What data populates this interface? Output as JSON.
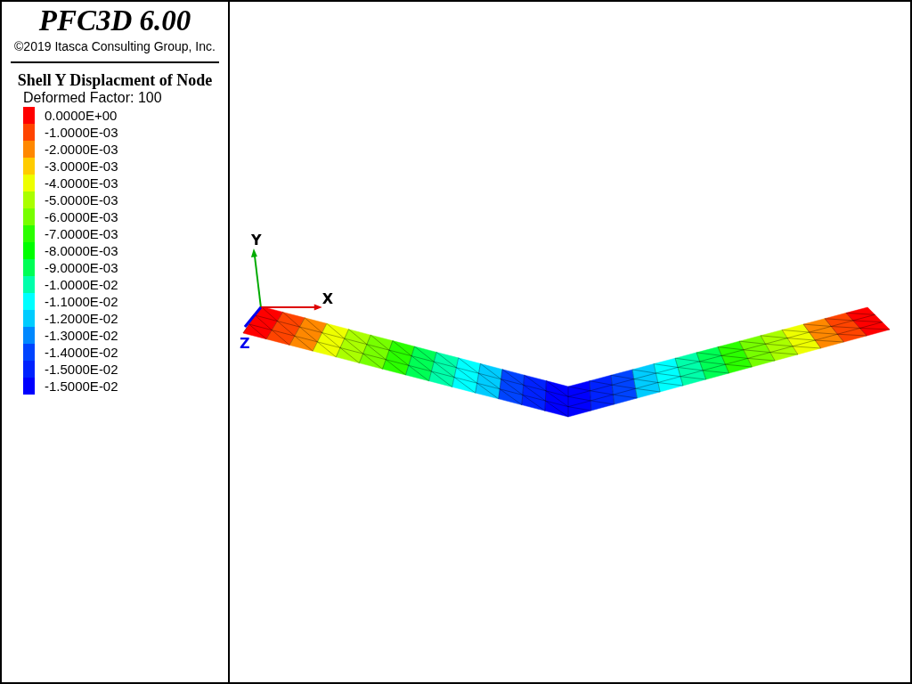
{
  "header": {
    "title": "PFC3D 6.00",
    "copyright": "©2019 Itasca Consulting Group, Inc."
  },
  "legend": {
    "title": "Shell Y Displacment of Node",
    "subtitle": "Deformed Factor: 100",
    "items": [
      {
        "label": "0.0000E+00",
        "color": "#ff0000"
      },
      {
        "label": "-1.0000E-03",
        "color": "#ff4400"
      },
      {
        "label": "-2.0000E-03",
        "color": "#ff8800"
      },
      {
        "label": "-3.0000E-03",
        "color": "#ffcc00"
      },
      {
        "label": "-4.0000E-03",
        "color": "#eeff00"
      },
      {
        "label": "-5.0000E-03",
        "color": "#aaff00"
      },
      {
        "label": "-6.0000E-03",
        "color": "#77ff00"
      },
      {
        "label": "-7.0000E-03",
        "color": "#2bff00"
      },
      {
        "label": "-8.0000E-03",
        "color": "#00ff00"
      },
      {
        "label": "-9.0000E-03",
        "color": "#00ff55"
      },
      {
        "label": "-1.0000E-02",
        "color": "#00ffaa"
      },
      {
        "label": "-1.1000E-02",
        "color": "#00ffff"
      },
      {
        "label": "-1.2000E-02",
        "color": "#00ccff"
      },
      {
        "label": "-1.3000E-02",
        "color": "#0088ff"
      },
      {
        "label": "-1.4000E-02",
        "color": "#0044ff"
      },
      {
        "label": "-1.5000E-02",
        "color": "#0022ff"
      },
      {
        "label": "-1.5000E-02",
        "color": "#0000ff"
      }
    ]
  },
  "plot": {
    "axes": {
      "x": "X",
      "y": "Y",
      "z": "Z"
    }
  }
}
